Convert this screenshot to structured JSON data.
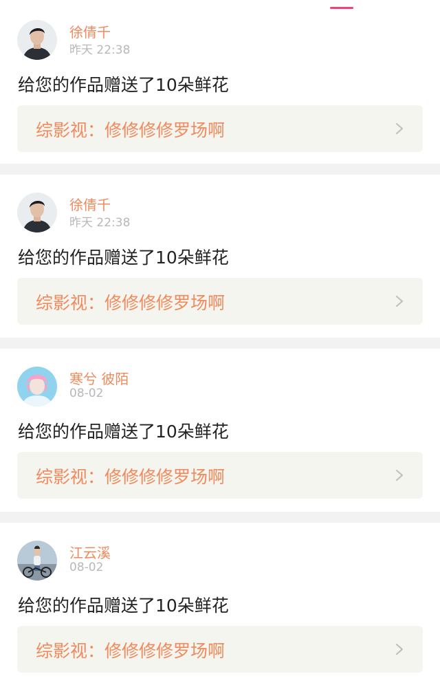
{
  "notifications": [
    {
      "username": "徐倩千",
      "time": "昨天 22:38",
      "message": "给您的作品赠送了10朵鲜花",
      "work_label": "综影视：修修修修罗场啊",
      "avatar_icon": "avatar-man-dark"
    },
    {
      "username": "徐倩千",
      "time": "昨天 22:38",
      "message": "给您的作品赠送了10朵鲜花",
      "work_label": "综影视：修修修修罗场啊",
      "avatar_icon": "avatar-man-dark"
    },
    {
      "username": "寒兮 彼陌",
      "time": "08-02",
      "message": "给您的作品赠送了10朵鲜花",
      "work_label": "综影视：修修修修罗场啊",
      "avatar_icon": "avatar-pink-hair"
    },
    {
      "username": "江云溪",
      "time": "08-02",
      "message": "给您的作品赠送了10朵鲜花",
      "work_label": "综影视：修修修修罗场啊",
      "avatar_icon": "avatar-bicycle"
    }
  ],
  "colors": {
    "accent_orange": "#f08a5d",
    "tab_underline": "#e8457f",
    "link_bg": "#f5f5ef"
  }
}
